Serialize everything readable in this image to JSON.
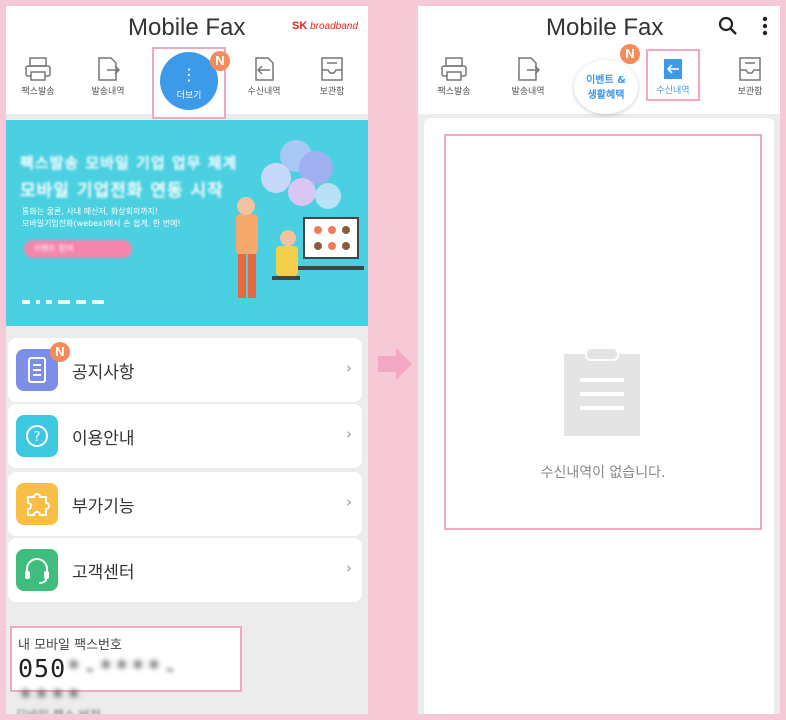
{
  "app": {
    "title": "Mobile Fax",
    "brand_sk": "SK",
    "brand_name": "broadband"
  },
  "left": {
    "tabs": [
      {
        "label": "팩스발송",
        "icon": "printer-icon"
      },
      {
        "label": "발송내역",
        "icon": "send-doc-icon"
      },
      {
        "label": "더보기",
        "icon": "more-icon",
        "active": true,
        "badge": "N"
      },
      {
        "label": "수신내역",
        "icon": "receive-doc-icon"
      },
      {
        "label": "보관함",
        "icon": "storage-icon"
      }
    ],
    "banner": {
      "line1": "팩스발송 모바일 기업 업무 체계",
      "line2": "모바일 기업전화 연동 시작",
      "desc1": "통화는 물론, 사내 메신저, 화상회의까지!",
      "desc2": "모바일기업전화(webex)에서 손 쉽게, 한 번에!",
      "button": "이벤트 참여"
    },
    "menu": [
      {
        "label": "공지사항",
        "icon": "notice-icon",
        "color": "#7b8ee8",
        "badge": "N"
      },
      {
        "label": "이용안내",
        "icon": "help-icon",
        "color": "#3cc8e0"
      },
      {
        "label": "부가기능",
        "icon": "puzzle-icon",
        "color": "#f9bf45"
      },
      {
        "label": "고객센터",
        "icon": "headset-icon",
        "color": "#3ebd7c"
      }
    ],
    "fax_label": "내 모바일 팩스번호",
    "fax_number_visible": "050",
    "fax_number_masked": "*-****-****",
    "bottom_text": "모바일 팩스 버전"
  },
  "right": {
    "tabs": [
      {
        "label": "팩스발송",
        "icon": "printer-icon"
      },
      {
        "label": "발송내역",
        "icon": "send-doc-icon"
      },
      {
        "label_line1": "이벤트 &",
        "label_line2": "생활혜택",
        "badge": "N"
      },
      {
        "label": "수신내역",
        "icon": "receive-doc-icon",
        "active": true
      },
      {
        "label": "보관함",
        "icon": "storage-icon"
      }
    ],
    "empty_message": "수신내역이 없습니다."
  },
  "colors": {
    "accent": "#3d9ae8",
    "highlight": "#f1a9c0",
    "badge": "#f58a5a",
    "banner": "#4ad0e0"
  }
}
